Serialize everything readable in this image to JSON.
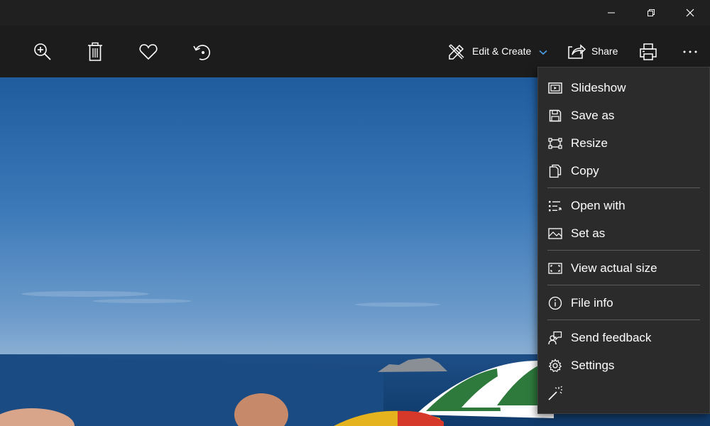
{
  "toolbar": {
    "edit_create_label": "Edit & Create",
    "share_label": "Share"
  },
  "menu": {
    "items": [
      {
        "label": "Slideshow",
        "icon": "slideshow-icon"
      },
      {
        "label": "Save as",
        "icon": "save-icon"
      },
      {
        "label": "Resize",
        "icon": "resize-icon"
      },
      {
        "label": "Copy",
        "icon": "copy-icon"
      },
      {
        "label": "Open with",
        "icon": "open-with-icon"
      },
      {
        "label": "Set as",
        "icon": "set-as-icon"
      },
      {
        "label": "View actual size",
        "icon": "actual-size-icon"
      },
      {
        "label": "File info",
        "icon": "info-icon"
      },
      {
        "label": "Send feedback",
        "icon": "feedback-icon"
      },
      {
        "label": "Settings",
        "icon": "gear-icon"
      }
    ]
  },
  "colors": {
    "accent": "#4ca2f0",
    "menu_bg": "#2b2b2b",
    "toolbar_bg": "#1c1c1c"
  }
}
